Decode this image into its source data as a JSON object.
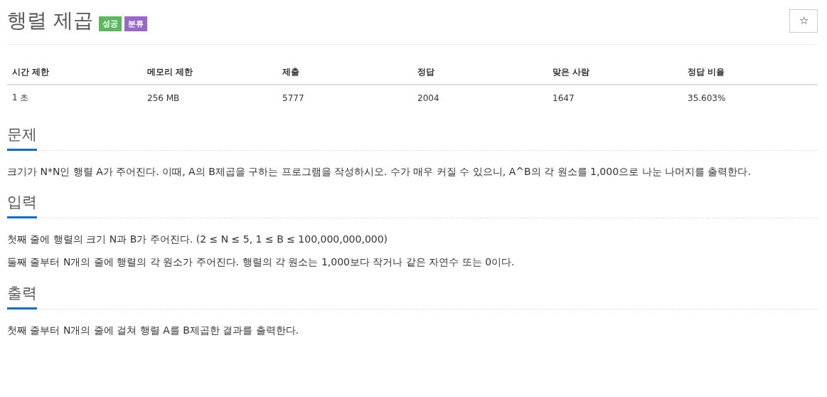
{
  "title": "행렬 제곱",
  "badges": [
    {
      "label": "성공",
      "color": "#5cb85c"
    },
    {
      "label": "분류",
      "color": "#9b66cc"
    }
  ],
  "star_button": "☆",
  "stats_table": {
    "columns": [
      "시간 제한",
      "메모리 제한",
      "제출",
      "정답",
      "맞은 사람",
      "정답 비율"
    ],
    "rows": [
      [
        "1 초",
        "256 MB",
        "5777",
        "2004",
        "1647",
        "35.603%"
      ]
    ]
  },
  "sections": [
    {
      "heading": "문제",
      "paragraphs": [
        "크기가 N*N인 행렬 A가 주어진다. 이때, A의 B제곱을 구하는 프로그램을 작성하시오. 수가 매우 커질 수 있으니, A^B의 각 원소를 1,000으로 나눈 나머지를 출력한다."
      ]
    },
    {
      "heading": "입력",
      "paragraphs": [
        "첫째 줄에 행렬의 크기 N과 B가 주어진다. (2 ≤ N ≤  5, 1 ≤ B ≤ 100,000,000,000)",
        "둘째 줄부터 N개의 줄에 행렬의 각 원소가 주어진다. 행렬의 각 원소는 1,000보다 작거나 같은 자연수 또는 0이다."
      ]
    },
    {
      "heading": "출력",
      "paragraphs": [
        "첫째 줄부터 N개의 줄에 걸쳐 행렬 A를 B제곱한 결과를 출력한다."
      ]
    }
  ]
}
